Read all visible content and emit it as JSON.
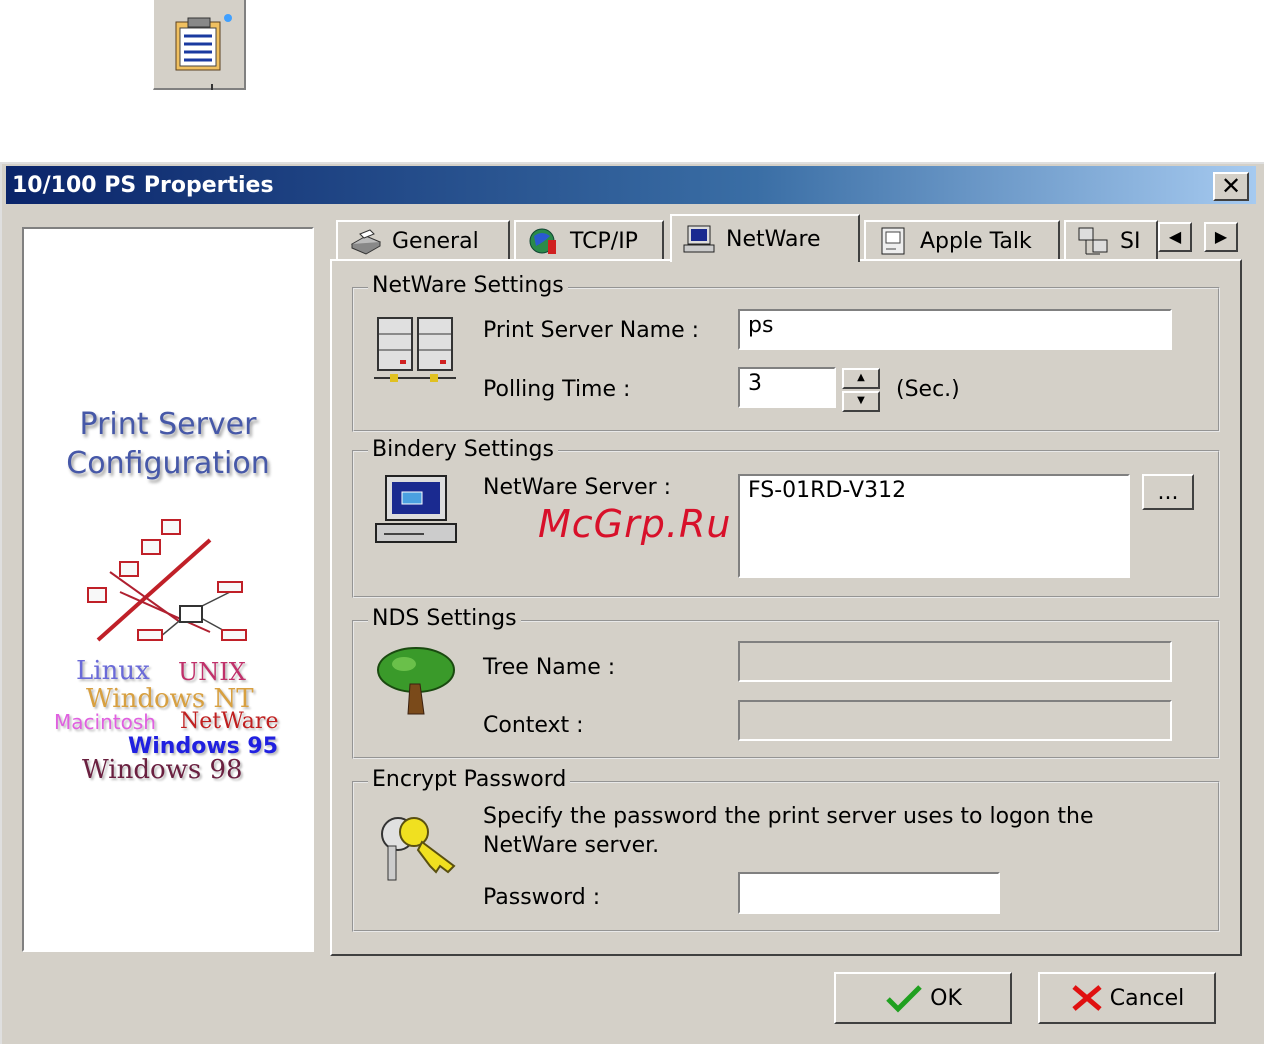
{
  "window": {
    "title": "10/100 PS Properties",
    "close_label": "✕"
  },
  "side": {
    "title_line1": "Print Server",
    "title_line2": "Configuration",
    "os": {
      "linux": "Linux",
      "unix": "UNIX",
      "winnt": "Windows NT",
      "mac": "Macintosh",
      "netware": "NetWare",
      "win95": "Windows 95",
      "win98": "Windows 98"
    },
    "os_colors": {
      "linux": "#6a6ad8",
      "unix": "#c0306a",
      "winnt": "#d8a040",
      "mac": "#e060e0",
      "netware": "#c02020",
      "win95": "#2020e0",
      "win98": "#6a2040"
    }
  },
  "tabs": [
    {
      "label": "General",
      "icon": "printer-icon"
    },
    {
      "label": "TCP/IP",
      "icon": "globe-icon"
    },
    {
      "label": "NetWare",
      "icon": "computer-icon",
      "active": true
    },
    {
      "label": "Apple Talk",
      "icon": "mac-icon"
    },
    {
      "label": "SI",
      "icon": "network-icon"
    }
  ],
  "scroll": {
    "left": "◀",
    "right": "▶"
  },
  "netware_settings": {
    "legend": "NetWare Settings",
    "print_server_name_label": "Print Server Name :",
    "print_server_name_value": "ps",
    "polling_time_label": "Polling Time :",
    "polling_time_value": "3",
    "polling_unit": "(Sec.)",
    "spin_up": "▲",
    "spin_down": "▼"
  },
  "bindery_settings": {
    "legend": "Bindery Settings",
    "server_label": "NetWare Server :",
    "server_value": "FS-01RD-V312",
    "browse_label": "..."
  },
  "nds_settings": {
    "legend": "NDS Settings",
    "tree_label": "Tree Name :",
    "tree_value": "",
    "context_label": "Context :",
    "context_value": ""
  },
  "encrypt_password": {
    "legend": "Encrypt Password",
    "description": "Specify the password the print server uses to logon the NetWare server.",
    "password_label": "Password :",
    "password_value": ""
  },
  "buttons": {
    "ok": "OK",
    "cancel": "Cancel"
  },
  "watermark": "McGrp.Ru",
  "colors": {
    "title_start": "#0a246a",
    "title_end": "#a6caf0",
    "face": "#d4d0c8"
  }
}
